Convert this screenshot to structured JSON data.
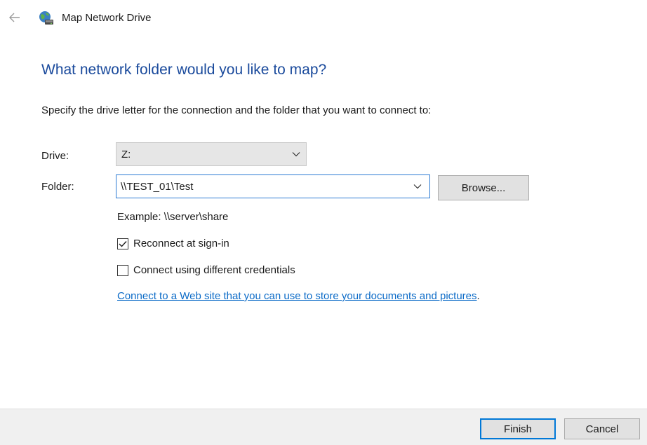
{
  "window": {
    "title": "Map Network Drive",
    "back_icon": "back-arrow-icon",
    "app_icon": "network-drive-icon"
  },
  "main": {
    "heading": "What network folder would you like to map?",
    "instructions": "Specify the drive letter for the connection and the folder that you want to connect to:",
    "drive": {
      "label": "Drive:",
      "value": "Z:"
    },
    "folder": {
      "label": "Folder:",
      "value": "\\\\TEST_01\\Test"
    },
    "browse_label": "Browse...",
    "example": "Example: \\\\server\\share",
    "reconnect": {
      "label": "Reconnect at sign-in",
      "checked": true
    },
    "different_credentials": {
      "label": "Connect using different credentials",
      "checked": false
    },
    "web_link": {
      "text": "Connect to a Web site that you can use to store your documents and pictures",
      "suffix": "."
    }
  },
  "footer": {
    "finish_label": "Finish",
    "cancel_label": "Cancel"
  },
  "colors": {
    "heading": "#1a4a9c",
    "link": "#0a6ac7",
    "focus_border": "#2b7bd4",
    "footer_bg": "#f0f0f0"
  }
}
